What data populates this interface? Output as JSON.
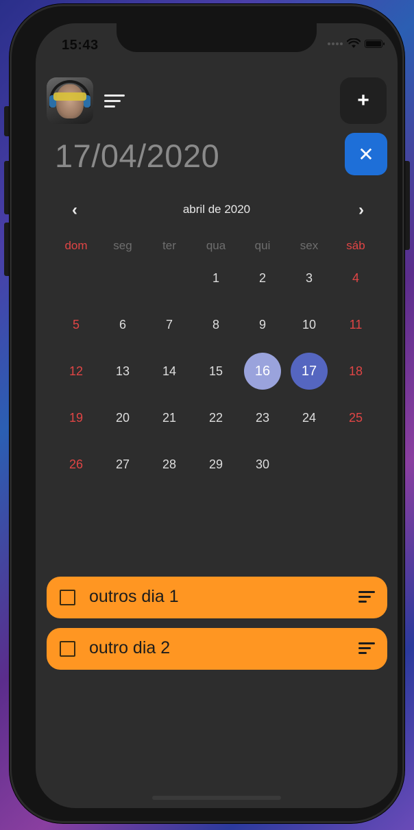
{
  "status_bar": {
    "time": "15:43"
  },
  "header": {
    "avatar_icon": "user-avatar",
    "menu_icon": "sort-lines-icon",
    "add_label": "+",
    "close_label": "✕"
  },
  "date_title": "17/04/2020",
  "calendar": {
    "month_label": "abril de 2020",
    "prev_label": "‹",
    "next_label": "›",
    "weekdays": [
      "dom",
      "seg",
      "ter",
      "qua",
      "qui",
      "sex",
      "sáb"
    ],
    "first_weekday_index": 3,
    "days": [
      "1",
      "2",
      "3",
      "4",
      "5",
      "6",
      "7",
      "8",
      "9",
      "10",
      "11",
      "12",
      "13",
      "14",
      "15",
      "16",
      "17",
      "18",
      "19",
      "20",
      "21",
      "22",
      "23",
      "24",
      "25",
      "26",
      "27",
      "28",
      "29",
      "30"
    ],
    "today": "16",
    "selected": "17"
  },
  "tasks": [
    {
      "label": "outros dia 1",
      "checked": false
    },
    {
      "label": "outro dia 2",
      "checked": false
    }
  ],
  "colors": {
    "accent_blue": "#1e6fd8",
    "task_orange": "#ff9622",
    "weekend_red": "#e04545",
    "selected_day": "#5566c0",
    "today_day": "#9aa3dc"
  }
}
